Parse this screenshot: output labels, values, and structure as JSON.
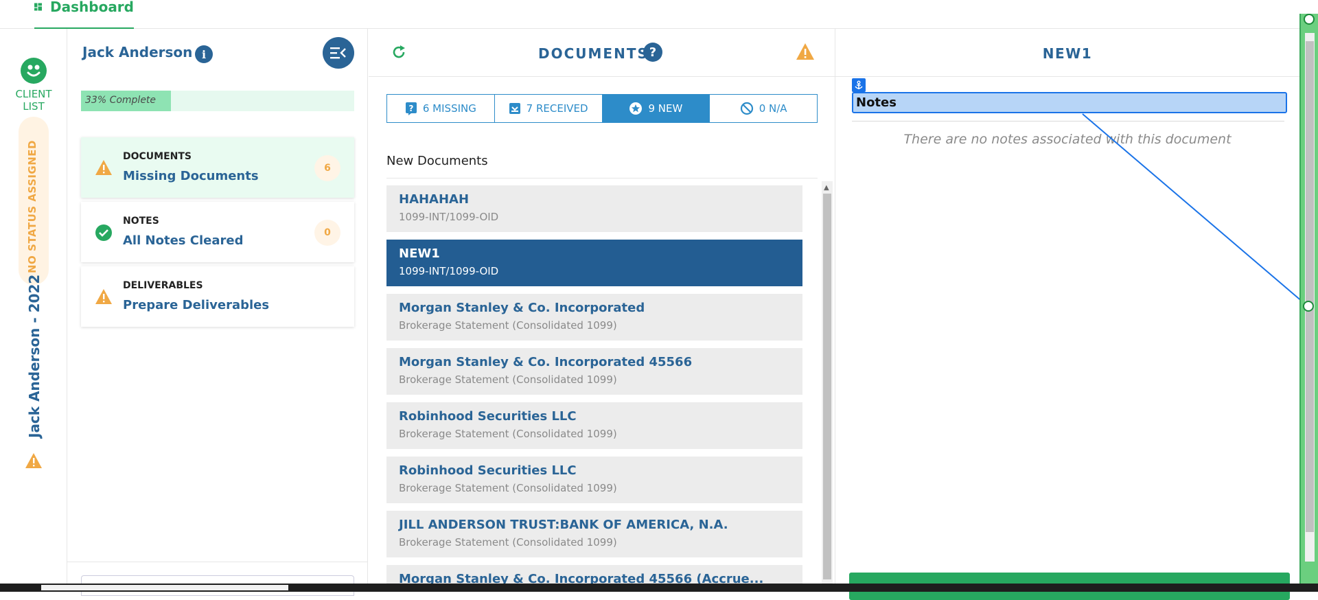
{
  "topbar": {
    "dashboard_label": "Dashboard"
  },
  "rail": {
    "client_list_label_1": "CLIENT",
    "client_list_label_2": "LIST",
    "status": "NO STATUS ASSIGNED",
    "client_year": "Jack Anderson - 2022"
  },
  "client": {
    "name": "Jack Anderson",
    "progress_label": "33% Complete",
    "progress_value": 0.33,
    "cards": [
      {
        "title": "DOCUMENTS",
        "subtitle": "Missing Documents",
        "count": "6",
        "status": "warning"
      },
      {
        "title": "NOTES",
        "subtitle": "All Notes Cleared",
        "count": "0",
        "status": "success"
      },
      {
        "title": "DELIVERABLES",
        "subtitle": "Prepare Deliverables",
        "status": "warning"
      }
    ]
  },
  "documents": {
    "title": "DOCUMENTS",
    "tabs": [
      {
        "label": "6 MISSING",
        "icon": "question-icon"
      },
      {
        "label": "7 RECEIVED",
        "icon": "inbox-icon"
      },
      {
        "label": "9 NEW",
        "icon": "star-icon"
      },
      {
        "label": "0 N/A",
        "icon": "ban-icon"
      }
    ],
    "section_title": "New Documents",
    "items": [
      {
        "name": "HAHAHAH",
        "type": "1099-INT/1099-OID"
      },
      {
        "name": "NEW1",
        "type": "1099-INT/1099-OID"
      },
      {
        "name": "Morgan Stanley & Co. Incorporated",
        "type": "Brokerage Statement (Consolidated 1099)"
      },
      {
        "name": "Morgan Stanley & Co. Incorporated 45566",
        "type": "Brokerage Statement (Consolidated 1099)"
      },
      {
        "name": "Robinhood Securities LLC",
        "type": "Brokerage Statement (Consolidated 1099)"
      },
      {
        "name": "Robinhood Securities LLC",
        "type": "Brokerage Statement (Consolidated 1099)"
      },
      {
        "name": "JILL ANDERSON TRUST:BANK OF AMERICA, N.A.",
        "type": "Brokerage Statement (Consolidated 1099)"
      },
      {
        "name": "Morgan Stanley & Co. Incorporated 45566 (Accrue...",
        "type": ""
      }
    ]
  },
  "detail": {
    "title": "NEW1",
    "notes_label": "Notes",
    "notes_empty": "There are no notes associated with this document"
  },
  "colors": {
    "brand_green": "#27a860",
    "brand_blue": "#2a6496",
    "accent_blue": "#2d8cc9",
    "selected_blue": "#235d92",
    "warning": "#f0a844"
  }
}
